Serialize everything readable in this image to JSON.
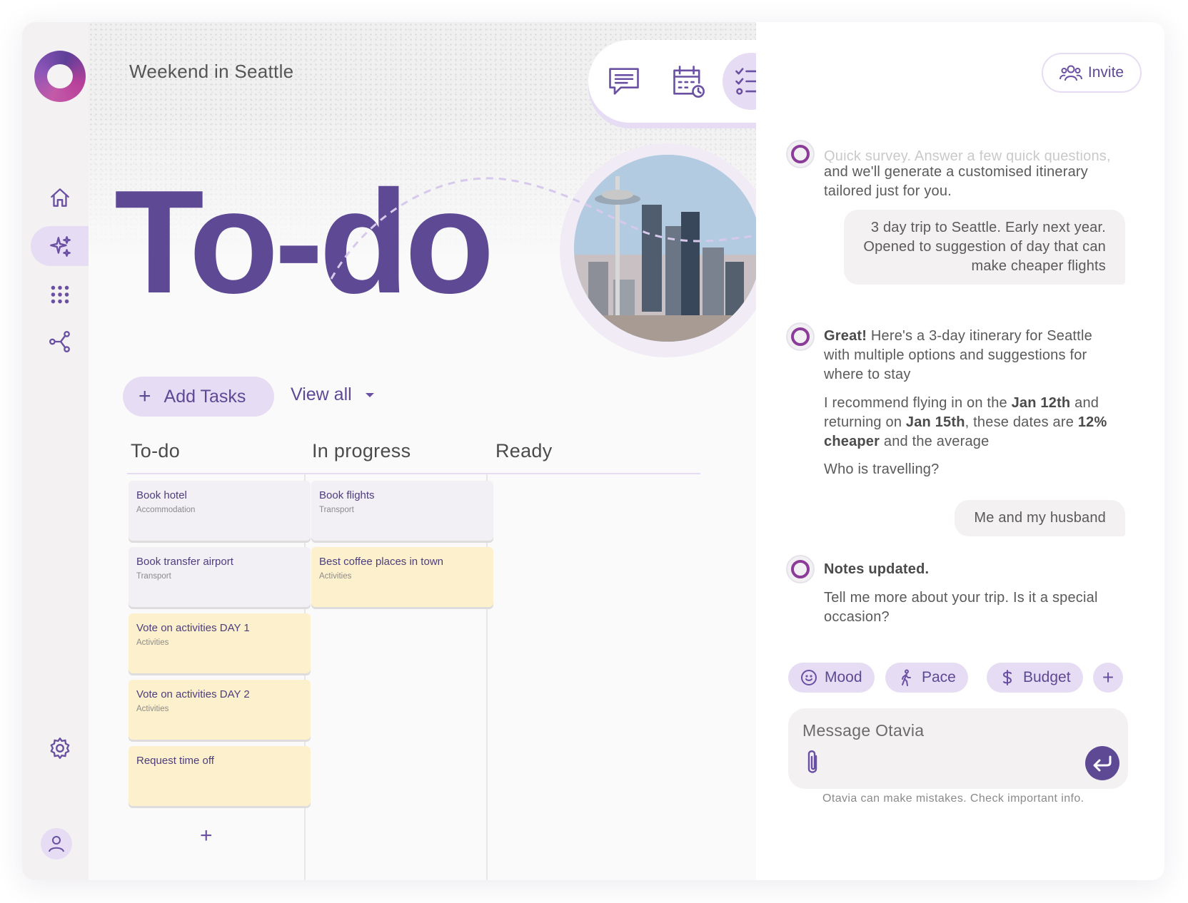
{
  "header": {
    "trip_title": "Weekend in Seattle",
    "page_title": "To-do",
    "invite_label": "Invite"
  },
  "toolbar": {
    "items": [
      {
        "icon": "chat-icon",
        "active": false
      },
      {
        "icon": "calendar-clock-icon",
        "active": false
      },
      {
        "icon": "checklist-icon",
        "active": true
      }
    ]
  },
  "sidebar": {
    "items": [
      {
        "icon": "home-icon"
      },
      {
        "icon": "sparkle-icon",
        "active": true
      },
      {
        "icon": "apps-grid-icon"
      },
      {
        "icon": "share-icon"
      },
      {
        "icon": "settings-gear-icon"
      },
      {
        "icon": "user-avatar-icon"
      }
    ]
  },
  "actions": {
    "add_tasks": "Add Tasks",
    "view_all": "View all"
  },
  "board": {
    "columns": [
      {
        "title": "To-do",
        "cards": [
          {
            "title": "Book hotel",
            "category": "Accommodation",
            "color": "grey"
          },
          {
            "title": "Book transfer airport",
            "category": "Transport",
            "color": "grey"
          },
          {
            "title": "Vote on activities DAY 1",
            "category": "Activities",
            "color": "yellow"
          },
          {
            "title": "Vote on activities DAY 2",
            "category": "Activities",
            "color": "yellow"
          },
          {
            "title": "Request time off",
            "category": "",
            "color": "yellow"
          }
        ]
      },
      {
        "title": "In progress",
        "cards": [
          {
            "title": "Book flights",
            "category": "Transport",
            "color": "grey"
          },
          {
            "title": "Best coffee places in town",
            "category": "Activities",
            "color": "yellow"
          }
        ]
      },
      {
        "title": "Ready",
        "cards": []
      }
    ]
  },
  "chat": {
    "m1_faded": "Quick survey. Answer a few quick questions,",
    "m1": "and we'll generate a customised itinerary tailored just for you.",
    "u1_line1": "3 day trip to Seattle. Early next year.",
    "u1_line2": "Opened to suggestion of day that can",
    "u1_line3": "make cheaper flights",
    "m2_bold": "Great!",
    "m2_rest": " Here's a 3-day itinerary for Seattle with multiple options and suggestions for where to stay",
    "m3_a": "I recommend flying in on the ",
    "m3_b": "Jan 12th",
    "m3_c": " and returning on ",
    "m3_d": "Jan 15th",
    "m3_e": ", these dates are ",
    "m3_f": "12% cheaper",
    "m3_g": " and the average",
    "m4": "Who is travelling?",
    "u2": "Me and my husband",
    "m5_bold": "Notes updated.",
    "m6": "Tell me more about your trip. Is it a special occasion?",
    "chips": [
      "Mood",
      "Pace",
      "Budget"
    ],
    "composer_placeholder": "Message Otavia",
    "disclaimer": "Otavia can make mistakes. Check important info."
  },
  "colors": {
    "accent": "#5e4995",
    "accent_light": "#e6dcf3",
    "card_grey": "#f2eff5",
    "card_yellow": "#fdf0cd"
  }
}
